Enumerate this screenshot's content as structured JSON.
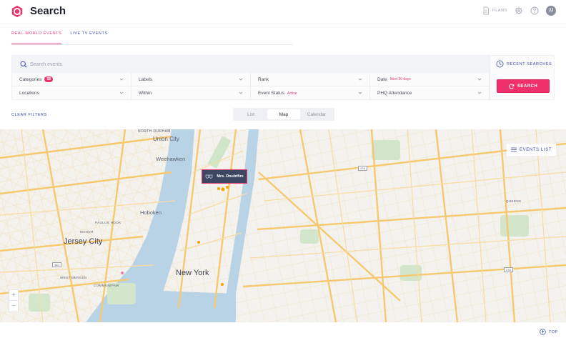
{
  "header": {
    "title": "Search",
    "plans_label": "PLANS",
    "avatar_initials": "JJ",
    "accent_color": "#e8376c"
  },
  "tabs": [
    {
      "label": "REAL-WORLD EVENTS",
      "active": true
    },
    {
      "label": "LIVE TV EVENTS",
      "active": false
    }
  ],
  "search": {
    "placeholder": "Search events",
    "value": "",
    "recent_label": "RECENT SEARCHES",
    "button_label": "SEARCH"
  },
  "filters": {
    "categories": {
      "label": "Categories",
      "badge": "58"
    },
    "labels": {
      "label": "Labels"
    },
    "rank": {
      "label": "Rank"
    },
    "date": {
      "label": "Date",
      "value": "Next 30 days"
    },
    "locations": {
      "label": "Locations"
    },
    "within": {
      "label": "Within"
    },
    "event_status": {
      "label": "Event Status",
      "value": "Active"
    },
    "attendance": {
      "label": "PHQ Attendance"
    }
  },
  "clear_filters_label": "CLEAR FILTERS",
  "view_toggle": [
    {
      "label": "List",
      "active": false
    },
    {
      "label": "Map",
      "active": true
    },
    {
      "label": "Calendar",
      "active": false
    }
  ],
  "map": {
    "events_list_label": "EVENTS LIST",
    "popup_label": "Mrs. Doubtfire",
    "zoom_in": "+",
    "zoom_out": "−",
    "places": {
      "north_durham": "NORTH DURHAM",
      "union_city": "Union City",
      "weehawken": "Weehawken",
      "hoboken": "Hoboken",
      "jersey_city": "Jersey City",
      "manor": "MANOR",
      "paulus_hook": "PAULUS HOOK",
      "west_bergen": "WEST BERGEN",
      "communipaw": "COMMUNIPAW",
      "new_york": "New York",
      "queens": "QUEENS",
      "route_440": "440",
      "route_278_a": "278",
      "route_278_b": "278"
    }
  },
  "footer": {
    "top_label": "TOP"
  }
}
